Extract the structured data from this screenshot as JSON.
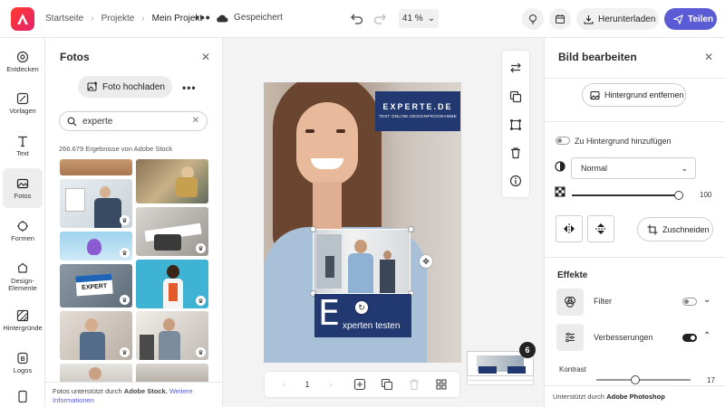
{
  "topbar": {
    "breadcrumb": [
      "Startseite",
      "Projekte",
      "Mein Projekt"
    ],
    "saved_status": "Gespeichert",
    "zoom": "41 %",
    "download_label": "Herunterladen",
    "share_label": "Teilen"
  },
  "rail": {
    "items": [
      {
        "label": "Entdecken",
        "icon": "discover-icon"
      },
      {
        "label": "Vorlagen",
        "icon": "templates-icon"
      },
      {
        "label": "Text",
        "icon": "text-icon"
      },
      {
        "label": "Fotos",
        "icon": "photos-icon",
        "active": true
      },
      {
        "label": "Formen",
        "icon": "shapes-icon"
      },
      {
        "label": "Design-Elemente",
        "icon": "design-elements-icon"
      },
      {
        "label": "Hintergründe",
        "icon": "backgrounds-icon"
      },
      {
        "label": "Logos",
        "icon": "logos-icon"
      }
    ]
  },
  "photos_panel": {
    "title": "Fotos",
    "upload_label": "Foto hochladen",
    "search_value": "experte",
    "results_count": "266.679 Ergebnisse von Adobe Stock",
    "footer_text": "Fotos unterstützt durch",
    "footer_brand": "Adobe Stock.",
    "footer_link": "Weitere Informationen"
  },
  "design": {
    "brand_title": "EXPERTE.DE",
    "brand_subtitle": "TEST ONLINE-DESIGNPROGRAMME",
    "headline_initial": "E",
    "headline_rest": "xperten testen",
    "badge_text": "EXPERT",
    "page_number": "1",
    "page_count": "6"
  },
  "edit_panel": {
    "title": "Bild bearbeiten",
    "remove_bg_label": "Hintergrund entfernen",
    "add_bg_label": "Zu Hintergrund hinzufügen",
    "blend_mode": "Normal",
    "opacity_value": "100",
    "opacity": 1.0,
    "crop_label": "Zuschneiden",
    "effects_title": "Effekte",
    "filter_label": "Filter",
    "enhance_label": "Verbesserungen",
    "contrast_label": "Kontrast",
    "contrast_value": "17",
    "footer_text": "Unterstützt durch",
    "footer_brand": "Adobe Photoshop"
  },
  "colors": {
    "accent": "#5b5bd6",
    "brand_navy": "#223870"
  }
}
